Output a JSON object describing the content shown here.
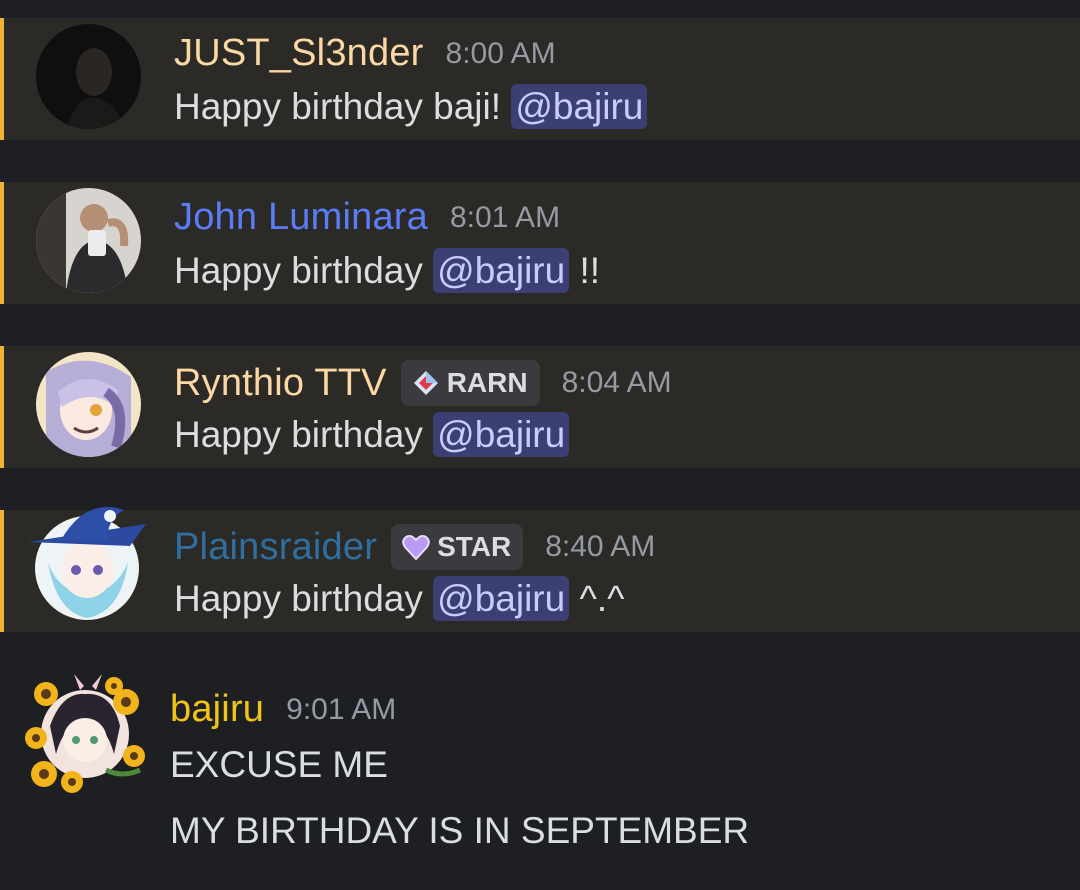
{
  "messages": [
    {
      "username": "JUST_Sl3nder",
      "username_color": "#fcd8a4",
      "timestamp": "8:00 AM",
      "text_before": "Happy birthday baji! ",
      "mention": "@bajiru",
      "text_after": ""
    },
    {
      "username": "John Luminara",
      "username_color": "#5b7cf7",
      "timestamp": "8:01 AM",
      "text_before": "Happy birthday ",
      "mention": "@bajiru",
      "text_after": " !!"
    },
    {
      "username": "Rynthio TTV",
      "username_color": "#fcd8a4",
      "tag": "RARN",
      "tag_icon": "diamond-gem-icon",
      "timestamp": "8:04 AM",
      "text_before": "Happy birthday ",
      "mention": "@bajiru",
      "text_after": ""
    },
    {
      "username": "Plainsraider",
      "username_color": "#2f6e9e",
      "tag": "STAR",
      "tag_icon": "purple-heart-icon",
      "timestamp": "8:40 AM",
      "text_before": "Happy birthday ",
      "mention": "@bajiru",
      "text_after": " ^.^"
    },
    {
      "username": "bajiru",
      "username_color": "#f0c419",
      "timestamp": "9:01 AM",
      "line1": "EXCUSE ME",
      "line2": "MY BIRTHDAY IS IN SEPTEMBER"
    }
  ],
  "colors": {
    "background": "#1e1f22",
    "highlight_bg": "#2c2a26",
    "highlight_bar": "#f0b232",
    "mention_bg": "#3c3f74",
    "mention_text": "#c9cdfb",
    "timestamp": "#949ba4",
    "text": "#dbdee1"
  }
}
